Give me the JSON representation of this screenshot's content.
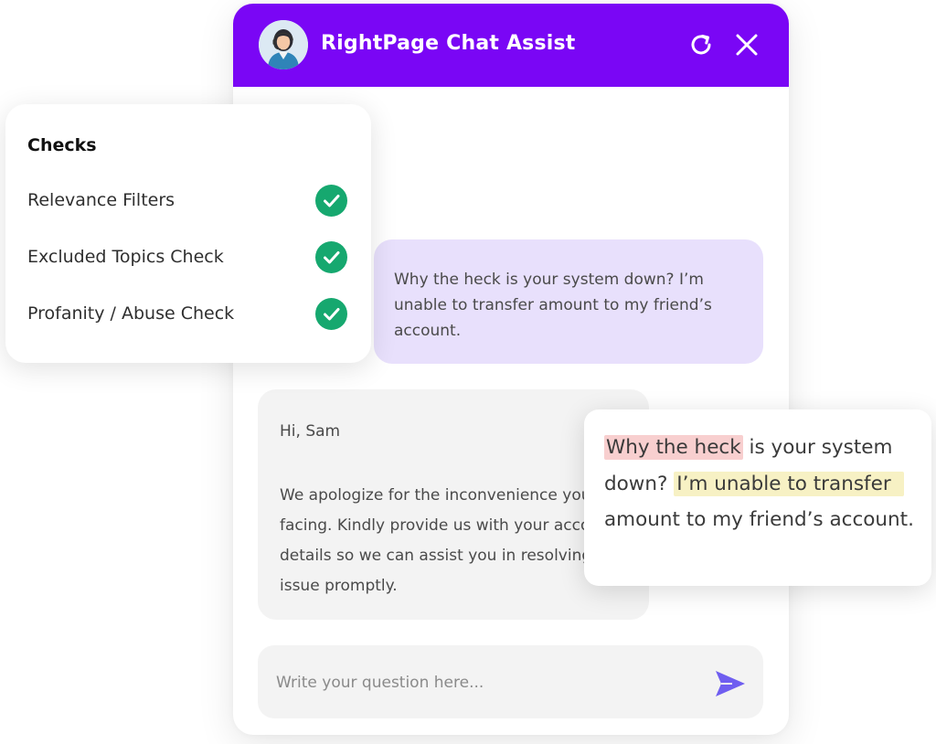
{
  "chat": {
    "title": "RightPage Chat Assist",
    "header_color": "#7a06f5",
    "user_message": "Why the heck is your system down? I’m unable to transfer amount to my friend’s account.",
    "bot_greeting": "Hi, Sam",
    "bot_message": "We apologize for the inconvenience you are facing. Kindly provide us with your account details so we can assist you in resolving this issue promptly.",
    "input_placeholder": "Write your question here...",
    "icons": {
      "avatar": "support-agent-avatar",
      "refresh": "refresh-icon",
      "close": "close-icon",
      "send": "send-icon"
    }
  },
  "checks": {
    "title": "Checks",
    "items": [
      {
        "label": "Relevance Filters",
        "status": "passed"
      },
      {
        "label": "Excluded Topics Check",
        "status": "passed"
      },
      {
        "label": "Profanity / Abuse Check",
        "status": "passed"
      }
    ],
    "check_color": "#16a86f"
  },
  "highlight": {
    "flagged_profanity": "Why the heck",
    "text_after_profanity": " is your system down? ",
    "flagged_topic": "I’m unable to transfer",
    "text_after_topic": " amount to my friend’s account.",
    "profanity_color": "#f8cfcf",
    "topic_color": "#f7f1c4"
  }
}
